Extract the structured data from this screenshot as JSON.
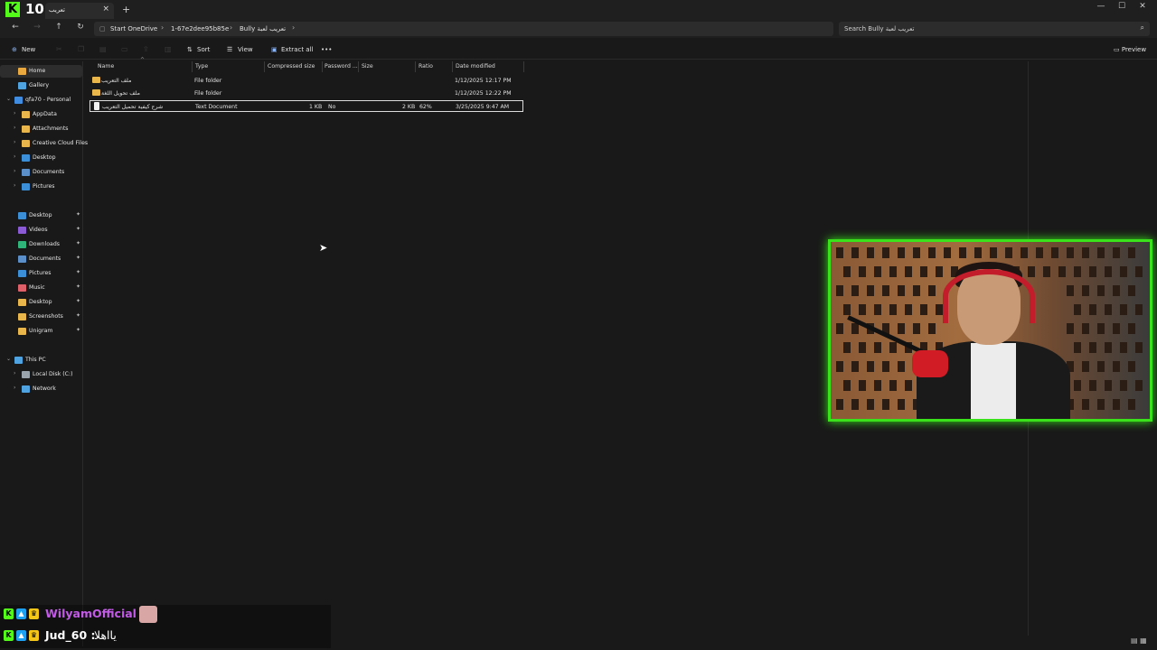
{
  "stream": {
    "viewer_count": "10",
    "chat": [
      {
        "user": "WilyamOfficial :",
        "message": "",
        "user_color": "#c45be8"
      },
      {
        "user": "Jud_60 :",
        "message": "يااهلا",
        "user_color": "#ffffff"
      }
    ]
  },
  "titlebar": {
    "tab_title": "تعريب",
    "tab_close": "×",
    "new_tab": "+",
    "minimize": "—",
    "maximize": "☐",
    "close": "✕"
  },
  "nav": {
    "back": "←",
    "forward": "→",
    "up": "↑",
    "refresh": "↻",
    "breadcrumbs": [
      "Start OneDrive",
      "1-67e2dee95b85e",
      "Bully تعريب لعبة"
    ],
    "search_placeholder": "Search Bully تعريب لعبة"
  },
  "commands": {
    "new": "New",
    "sort": "Sort",
    "view": "View",
    "extract_all": "Extract all",
    "more": "•••",
    "preview": "Preview"
  },
  "sidebar": {
    "top": [
      {
        "label": "Home",
        "icon": "home-icon",
        "color": "#e9a93e"
      },
      {
        "label": "Gallery",
        "icon": "gallery-icon",
        "color": "#4fa3e0"
      },
      {
        "label": "qfa70 - Personal",
        "icon": "onedrive-icon",
        "color": "#3f8ce0"
      },
      {
        "label": "AppData",
        "icon": "folder-icon",
        "color": "#e8b64a"
      },
      {
        "label": "Attachments",
        "icon": "folder-icon",
        "color": "#e8b64a"
      },
      {
        "label": "Creative Cloud Files",
        "icon": "folder-icon",
        "color": "#e8b64a"
      },
      {
        "label": "Desktop",
        "icon": "desktop-icon",
        "color": "#3b8fd9"
      },
      {
        "label": "Documents",
        "icon": "documents-icon",
        "color": "#5b8fc9"
      },
      {
        "label": "Pictures",
        "icon": "pictures-icon",
        "color": "#3b8fd9"
      }
    ],
    "quick": [
      {
        "label": "Desktop",
        "icon": "desktop-icon",
        "color": "#3b8fd9"
      },
      {
        "label": "Videos",
        "icon": "videos-icon",
        "color": "#8b5bd6"
      },
      {
        "label": "Downloads",
        "icon": "downloads-icon",
        "color": "#2fb47a"
      },
      {
        "label": "Documents",
        "icon": "documents-icon",
        "color": "#5b8fc9"
      },
      {
        "label": "Pictures",
        "icon": "pictures-icon",
        "color": "#3b8fd9"
      },
      {
        "label": "Music",
        "icon": "music-icon",
        "color": "#e0606a"
      },
      {
        "label": "Desktop",
        "icon": "folder-icon",
        "color": "#e8b64a"
      },
      {
        "label": "Screenshots",
        "icon": "folder-icon",
        "color": "#e8b64a"
      },
      {
        "label": "Unigram",
        "icon": "folder-icon",
        "color": "#e8b64a"
      }
    ],
    "devices": [
      {
        "label": "This PC",
        "icon": "pc-icon",
        "color": "#4fa3e0"
      },
      {
        "label": "Local Disk (C:)",
        "icon": "disk-icon",
        "color": "#9aa4ad"
      },
      {
        "label": "Network",
        "icon": "network-icon",
        "color": "#4fa3e0"
      }
    ]
  },
  "columns": {
    "name": "Name",
    "type": "Type",
    "compressed": "Compressed size",
    "password": "Password ...",
    "size": "Size",
    "ratio": "Ratio",
    "date": "Date modified"
  },
  "files": [
    {
      "name": "ملف التعريب",
      "type": "File folder",
      "compressed": "",
      "password": "",
      "size": "",
      "ratio": "",
      "date": "1/12/2025 12:17 PM",
      "kind": "folder"
    },
    {
      "name": "ملف تحويل اللغة",
      "type": "File folder",
      "compressed": "",
      "password": "",
      "size": "",
      "ratio": "",
      "date": "1/12/2025 12:22 PM",
      "kind": "folder"
    },
    {
      "name": "شرح كيفية تحميل التعريب",
      "type": "Text Document",
      "compressed": "1 KB",
      "password": "No",
      "size": "2 KB",
      "ratio": "62%",
      "date": "3/25/2025 9:47 AM",
      "kind": "text"
    }
  ],
  "colors": {
    "webcam_border": "#39e21a",
    "kick_green": "#53fc18"
  }
}
